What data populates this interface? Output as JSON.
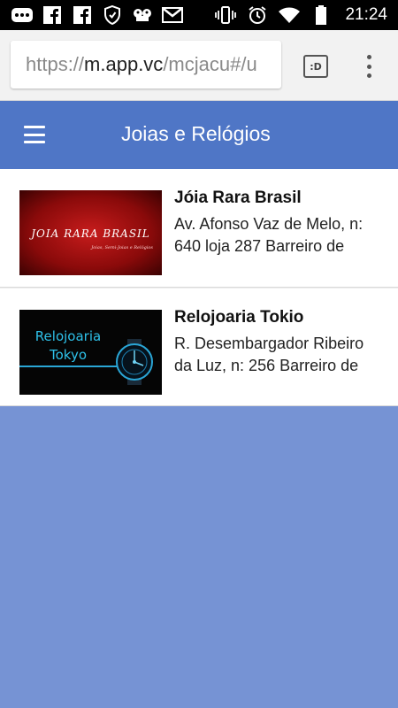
{
  "status_bar": {
    "time": "21:24",
    "icons": [
      "more-icon",
      "facebook-icon",
      "facebook-icon",
      "shield-icon",
      "bird-icon",
      "gmail-icon",
      "vibrate-icon",
      "alarm-icon",
      "wifi-icon",
      "battery-icon"
    ]
  },
  "browser": {
    "url_scheme": "https://",
    "url_host": "m.app.vc",
    "url_path": "/mcjacu#/u",
    "tabs_label": ":D"
  },
  "app": {
    "title": "Joias e Relógios",
    "header_color": "#4f76c6",
    "background_color": "#7693d4"
  },
  "items": [
    {
      "name": "Jóia Rara Brasil",
      "address_line1": "Av. Afonso Vaz de Melo, n:",
      "address_line2": "640 loja 287 Barreiro de",
      "thumb_logo": "JOIA RARA BRASIL",
      "thumb_sub": "Joias, Semi-Joias e Relógios"
    },
    {
      "name": "Relojoaria Tokio",
      "address_line1": "R. Desembargador Ribeiro",
      "address_line2": "da Luz, n: 256 Barreiro de",
      "thumb_logo_line1": "Relojoaria",
      "thumb_logo_line2": "Tokyo"
    }
  ]
}
